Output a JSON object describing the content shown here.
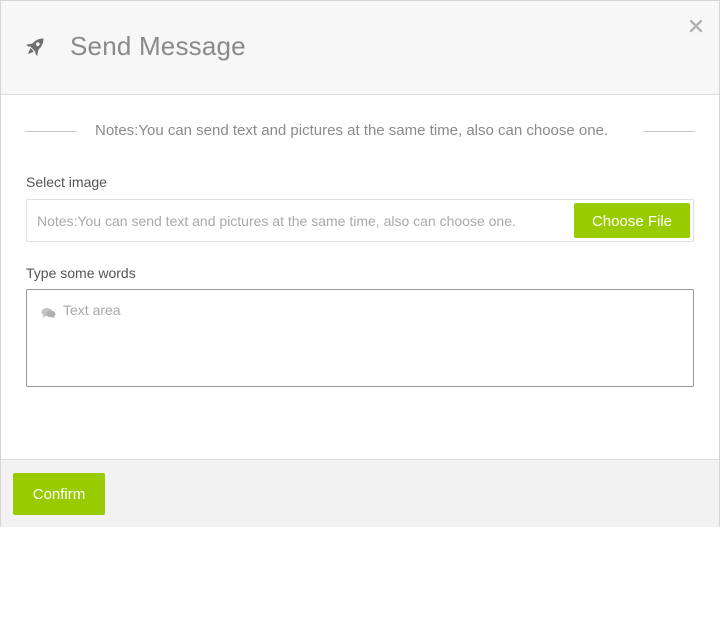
{
  "dialog": {
    "title": "Send Message",
    "title_icon": "rocket-icon",
    "close_icon": "close-icon",
    "notes": "Notes:You can send text and pictures at the same time, also can choose one."
  },
  "image_field": {
    "label": "Select image",
    "placeholder": "Notes:You can send text and pictures at the same time, also can choose one.",
    "button_label": "Choose File"
  },
  "words_field": {
    "label": "Type some words",
    "icon": "chat-icon",
    "placeholder": "Text area",
    "value": ""
  },
  "footer": {
    "confirm_label": "Confirm"
  },
  "colors": {
    "accent": "#99cc00",
    "header_bg": "#f7f7f7",
    "footer_bg": "#f2f2f2",
    "muted_text": "#8a8a8a"
  }
}
